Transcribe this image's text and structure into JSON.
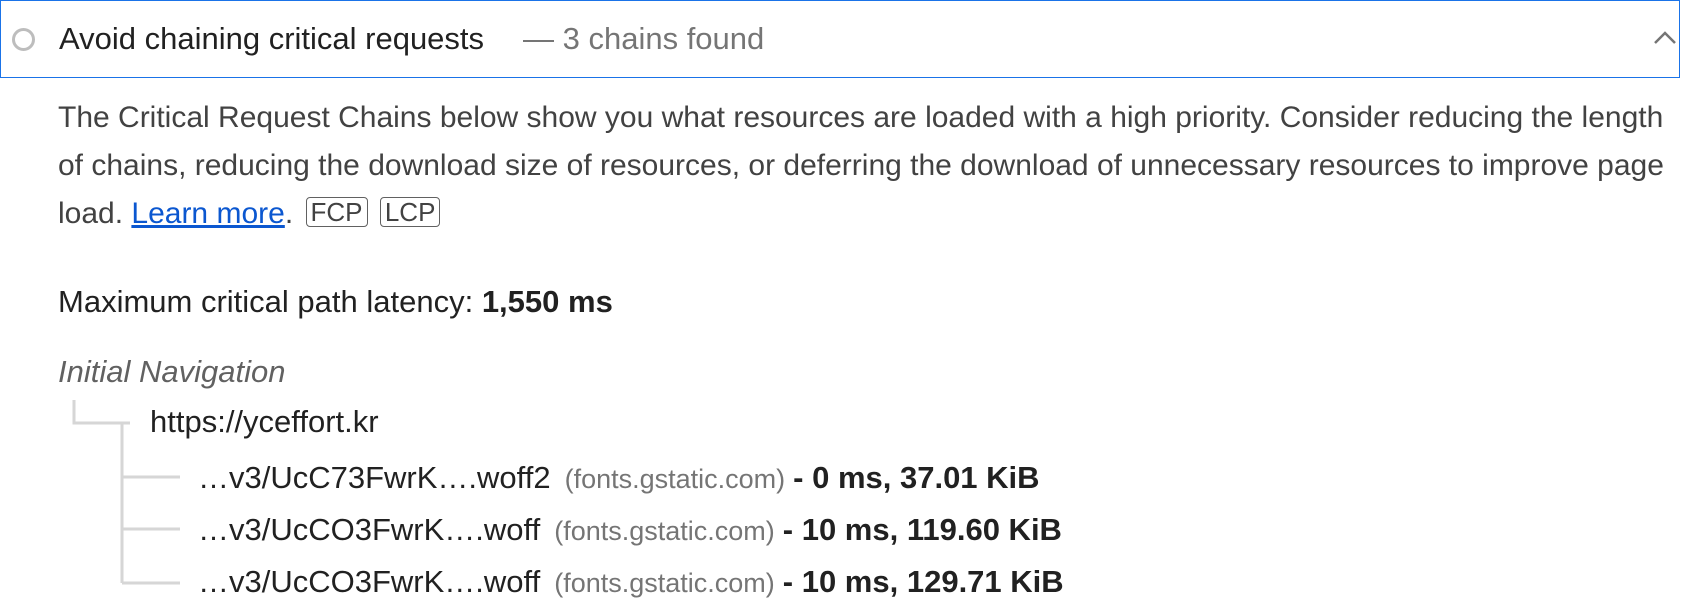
{
  "audit": {
    "title": "Avoid chaining critical requests",
    "display_value": "— 3 chains found",
    "description_text": "The Critical Request Chains below show you what resources are loaded with a high priority. Consider reducing the length of chains, reducing the download size of resources, or deferring the download of unnecessary resources to improve page load. ",
    "learn_more": "Learn more",
    "period": ".",
    "tags": [
      "FCP",
      "LCP"
    ],
    "latency_label": "Maximum critical path latency: ",
    "latency_value": "1,550 ms"
  },
  "chains": {
    "navigation_label": "Initial Navigation",
    "root_url": "https://yceffort.kr",
    "items": [
      {
        "file": "…v3/UcC73FwrK….woff2",
        "host": "(fonts.gstatic.com)",
        "stats": "- 0 ms, 37.01 KiB"
      },
      {
        "file": "…v3/UcCO3FwrK….woff",
        "host": "(fonts.gstatic.com)",
        "stats": "- 10 ms, 119.60 KiB"
      },
      {
        "file": "…v3/UcCO3FwrK….woff",
        "host": "(fonts.gstatic.com)",
        "stats": "- 10 ms, 129.71 KiB"
      }
    ]
  },
  "colors": {
    "focus_border": "#1a73e8",
    "link": "#0b57d0",
    "tree_line": "#d6d6d6",
    "muted_text": "#757575"
  },
  "icons": {
    "status": "neutral-circle-icon",
    "toggle": "chevron-up-icon"
  }
}
